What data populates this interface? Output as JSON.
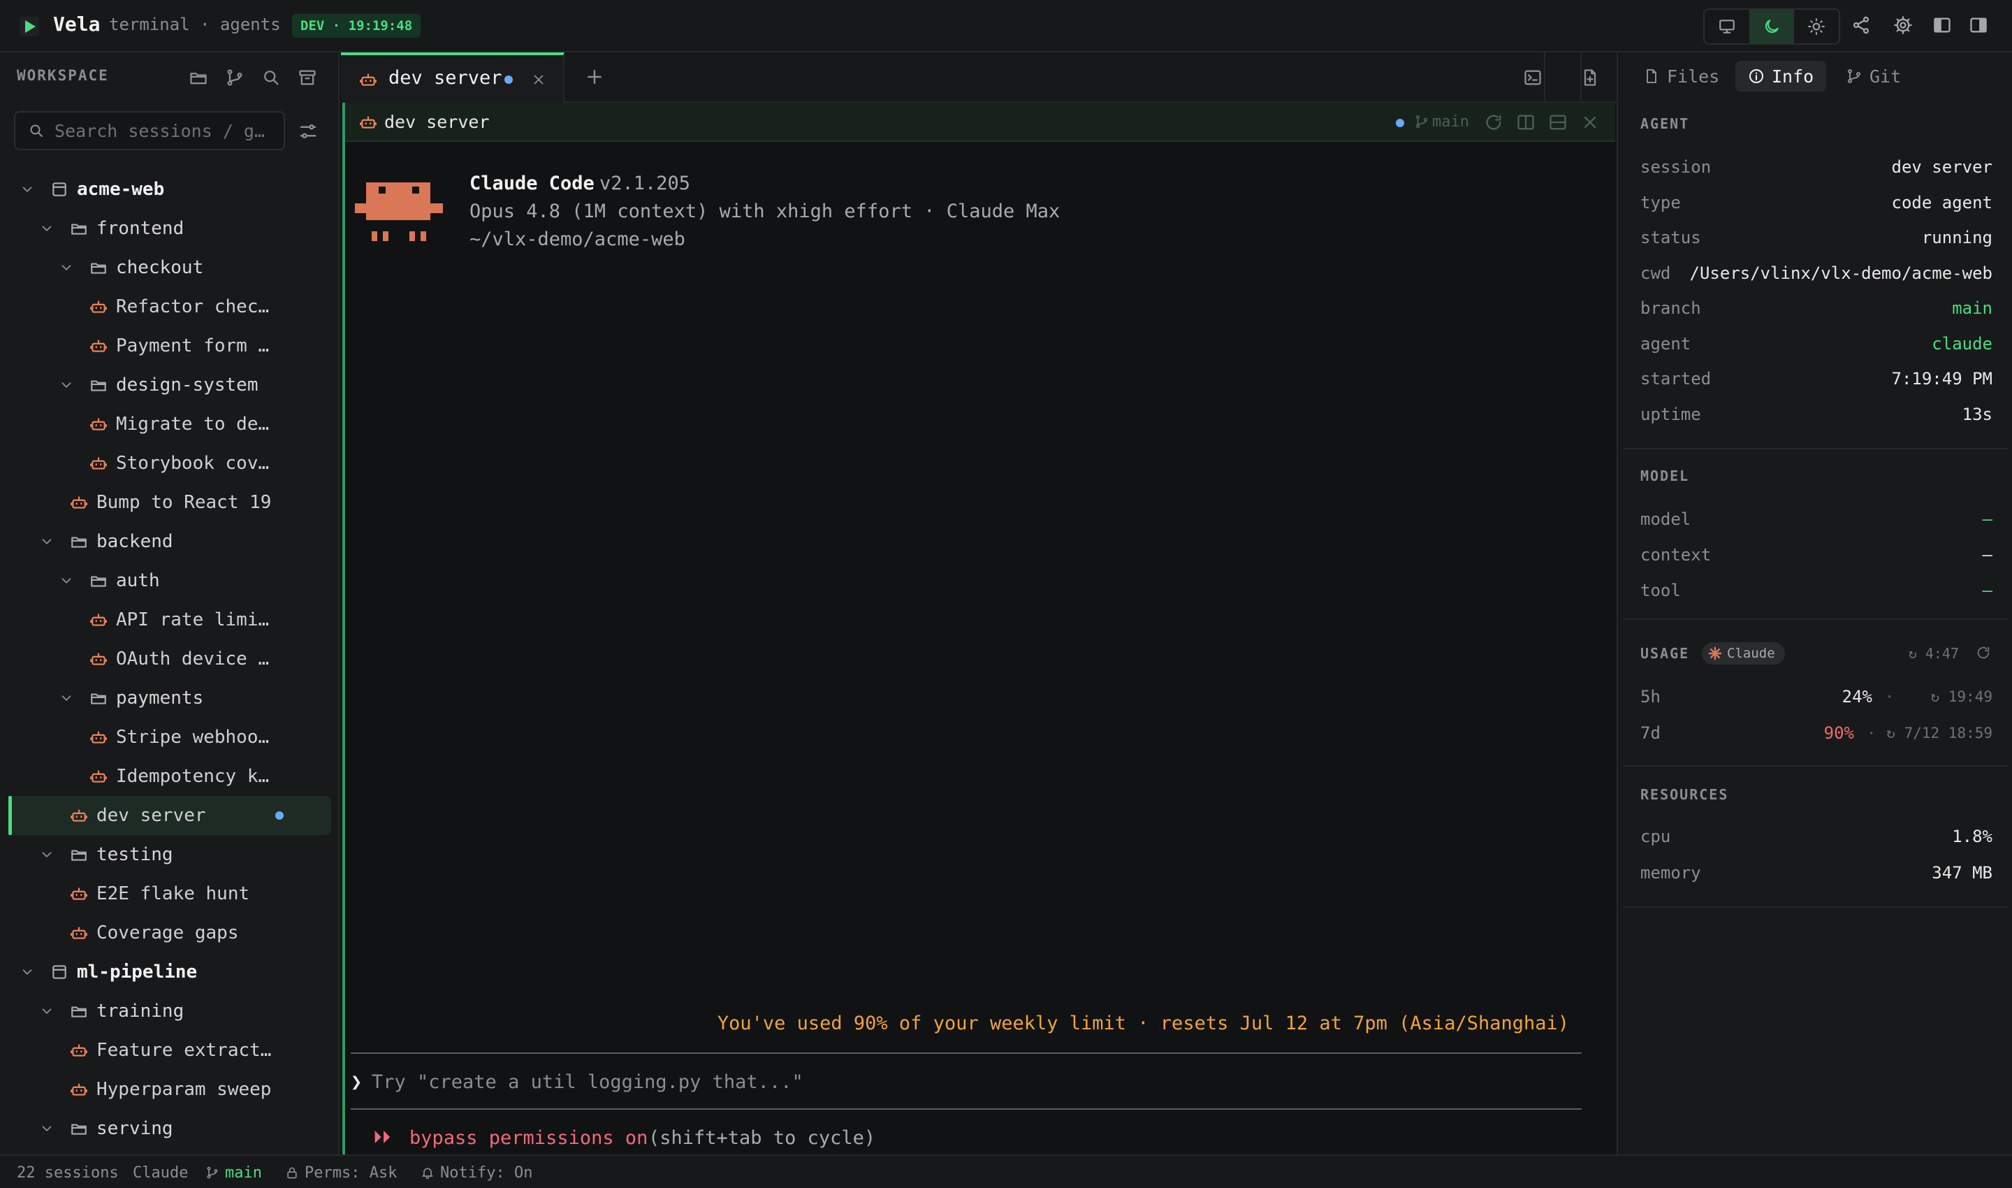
{
  "app": {
    "name": "Vela",
    "subtitle": "terminal · agents",
    "badge": "DEV · 19:19:48"
  },
  "titlebar": {
    "icons": [
      "monitor-icon",
      "moon-icon",
      "sun-icon",
      "share-icon",
      "gear-icon",
      "sidebar-left-icon",
      "sidebar-right-icon"
    ],
    "active_theme": "dark"
  },
  "sidebar": {
    "title": "WORKSPACE",
    "search_placeholder": "Search sessions / g…",
    "tree": [
      {
        "kind": "workspace",
        "depth": 0,
        "label": "acme-web"
      },
      {
        "kind": "folder",
        "depth": 1,
        "label": "frontend"
      },
      {
        "kind": "folder",
        "depth": 2,
        "label": "checkout"
      },
      {
        "kind": "session",
        "depth": 3,
        "label": "Refactor chec…"
      },
      {
        "kind": "session",
        "depth": 3,
        "label": "Payment form …"
      },
      {
        "kind": "folder",
        "depth": 2,
        "label": "design-system"
      },
      {
        "kind": "session",
        "depth": 3,
        "label": "Migrate to de…"
      },
      {
        "kind": "session",
        "depth": 3,
        "label": "Storybook cov…"
      },
      {
        "kind": "session",
        "depth": 2,
        "label": "Bump to React 19"
      },
      {
        "kind": "folder",
        "depth": 1,
        "label": "backend"
      },
      {
        "kind": "folder",
        "depth": 2,
        "label": "auth"
      },
      {
        "kind": "session",
        "depth": 3,
        "label": "API rate limi…"
      },
      {
        "kind": "session",
        "depth": 3,
        "label": "OAuth device …"
      },
      {
        "kind": "folder",
        "depth": 2,
        "label": "payments"
      },
      {
        "kind": "session",
        "depth": 3,
        "label": "Stripe webhoo…"
      },
      {
        "kind": "session",
        "depth": 3,
        "label": "Idempotency k…"
      },
      {
        "kind": "session",
        "depth": 2,
        "label": "dev server",
        "active": true
      },
      {
        "kind": "folder",
        "depth": 1,
        "label": "testing"
      },
      {
        "kind": "session",
        "depth": 2,
        "label": "E2E flake hunt"
      },
      {
        "kind": "session",
        "depth": 2,
        "label": "Coverage gaps"
      },
      {
        "kind": "workspace",
        "depth": 0,
        "label": "ml-pipeline"
      },
      {
        "kind": "folder",
        "depth": 1,
        "label": "training"
      },
      {
        "kind": "session",
        "depth": 2,
        "label": "Feature extract…"
      },
      {
        "kind": "session",
        "depth": 2,
        "label": "Hyperparam sweep"
      },
      {
        "kind": "folder",
        "depth": 1,
        "label": "serving"
      }
    ]
  },
  "tabs": [
    {
      "label": "dev server",
      "active": true,
      "modified": true
    }
  ],
  "pane": {
    "title": "dev server",
    "branch": "main",
    "banner": {
      "title": "Claude Code",
      "version": "v2.1.205",
      "model_line": "Opus 4.8 (1M context) with xhigh effort · Claude Max",
      "path": "~/vlx-demo/acme-web"
    },
    "limit_message": "You've used 90% of your weekly limit · resets Jul 12 at 7pm (Asia/Shanghai)",
    "prompt_caret": "❯",
    "prompt_placeholder": "Try \"create a util logging.py that...\"",
    "bypass_arrows": "⏵⏵",
    "bypass_label": "bypass permissions on",
    "bypass_hint": "(shift+tab to cycle)"
  },
  "right_panel": {
    "tabs": [
      {
        "label": "Files"
      },
      {
        "label": "Info",
        "active": true
      },
      {
        "label": "Git"
      }
    ],
    "agent": {
      "title": "AGENT",
      "rows": [
        {
          "k": "session",
          "v": "dev server"
        },
        {
          "k": "type",
          "v": "code agent"
        },
        {
          "k": "status",
          "v": "running"
        },
        {
          "k": "cwd",
          "v": "/Users/vlinx/vlx-demo/acme-web"
        },
        {
          "k": "branch",
          "v": "main",
          "color": "green"
        },
        {
          "k": "agent",
          "v": "claude",
          "color": "green"
        },
        {
          "k": "started",
          "v": "7:19:49 PM"
        },
        {
          "k": "uptime",
          "v": "13s"
        }
      ]
    },
    "model": {
      "title": "MODEL",
      "rows": [
        {
          "k": "model",
          "v": "—",
          "color": "green"
        },
        {
          "k": "context",
          "v": "—"
        },
        {
          "k": "tool",
          "v": "—",
          "color": "green"
        }
      ]
    },
    "usage": {
      "title": "USAGE",
      "badge": "Claude",
      "refresh_time": "↻ 4:47",
      "rows": [
        {
          "k": "5h",
          "pct": "24%",
          "reset": "↻ 19:49"
        },
        {
          "k": "7d",
          "pct": "90%",
          "reset": "↻ 7/12 18:59",
          "color": "red"
        }
      ]
    },
    "resources": {
      "title": "RESOURCES",
      "rows": [
        {
          "k": "cpu",
          "v": "1.8%"
        },
        {
          "k": "memory",
          "v": "347 MB"
        }
      ]
    }
  },
  "statusbar": {
    "sessions": "22 sessions",
    "agent": "Claude",
    "branch": "main",
    "perms": "Perms: Ask",
    "notify": "Notify: On"
  },
  "colors": {
    "accent": "#4ade80",
    "session_icon": "#f0855b",
    "warning": "#f0a43a",
    "danger": "#f26a7a",
    "dot": "#6aa9f5"
  }
}
